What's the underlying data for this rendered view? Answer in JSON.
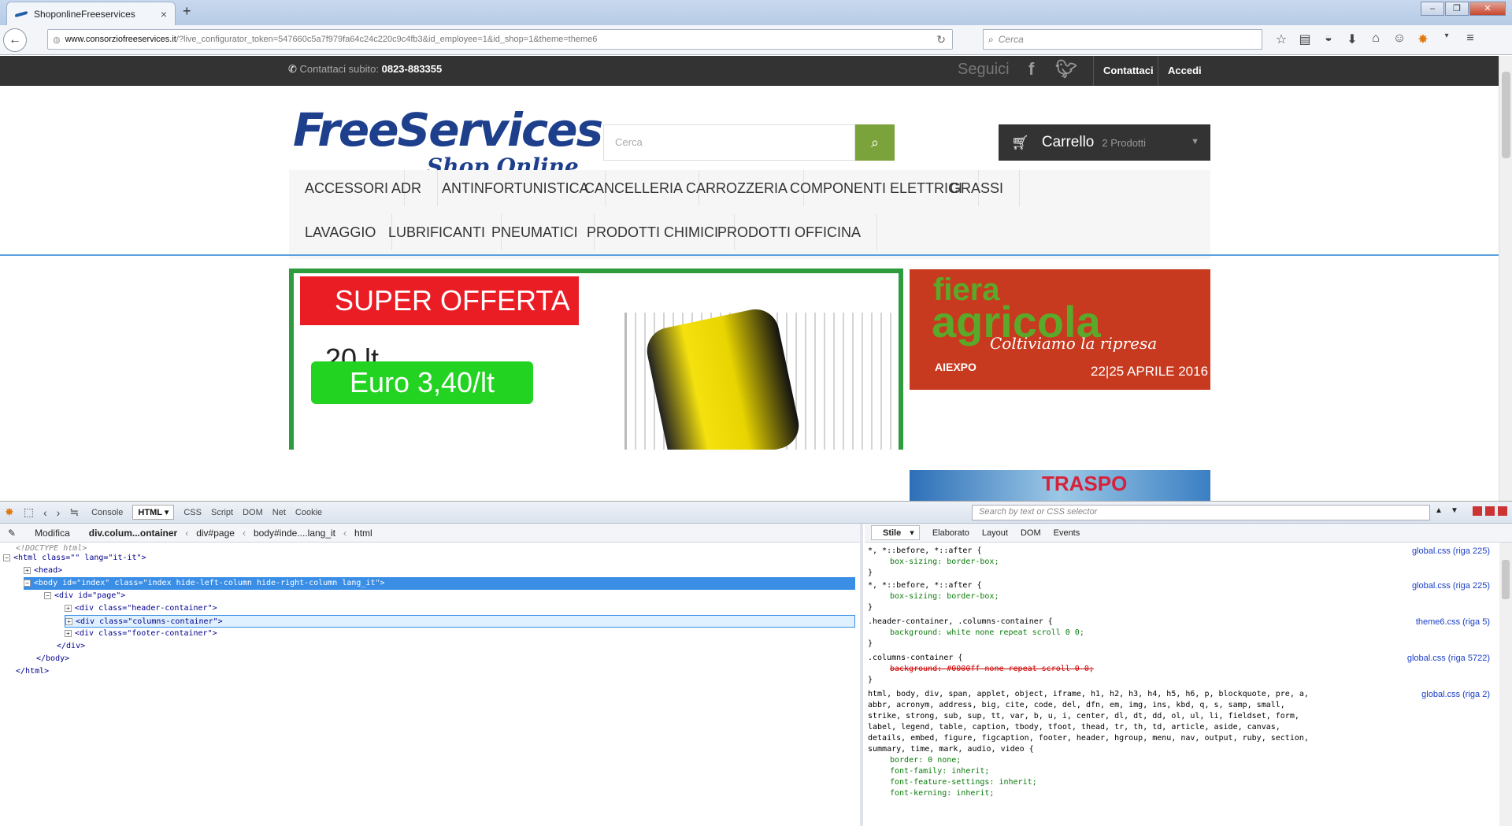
{
  "browser": {
    "tab_title": "ShoponlineFreeservices",
    "url_domain": "www.consorziofreeservices.it",
    "url_path": "/?live_configurator_token=547660c5a7f979fa64c24c220c9c4fb3&id_employee=1&id_shop=1&theme=theme6",
    "search_placeholder": "Cerca"
  },
  "site": {
    "topbar": {
      "contact_label": "Contattaci subito:",
      "phone": "0823-883355",
      "follow": "Seguici",
      "contact_link": "Contattaci",
      "login": "Accedi"
    },
    "logo": {
      "line1": "FreeServices",
      "line2": "Shop Online"
    },
    "search_placeholder": "Cerca",
    "cart": {
      "label": "Carrello",
      "count": "2 Prodotti"
    },
    "menu": [
      "ACCESSORI",
      "ADR",
      "ANTINFORTUNISTICA",
      "CANCELLERIA",
      "CARROZZERIA",
      "COMPONENTI ELETTRICI",
      "GRASSI",
      "LAVAGGIO",
      "LUBRIFICANTI",
      "PNEUMATICI",
      "PRODOTTI CHIMICI",
      "PRODOTTI OFFICINA"
    ],
    "promo": {
      "title": "SUPER OFFERTA",
      "size": "20 lt",
      "price": "Euro 3,40/lt"
    },
    "banner_fiera": {
      "a": "fiera",
      "b": "agricola",
      "slogan": "Coltiviamo la ripresa",
      "org": "AIEXPO",
      "dates": "22|25 APRILE 2016"
    },
    "banner_traspo": "TRASPO"
  },
  "devtools": {
    "tabs": [
      "Console",
      "HTML",
      "CSS",
      "Script",
      "DOM",
      "Net",
      "Cookie"
    ],
    "active_tab": "HTML",
    "search_placeholder": "Search by text or CSS selector",
    "edit": "Modifica",
    "breadcrumb": [
      "div.colum...ontainer",
      "div#page",
      "body#inde....lang_it",
      "html"
    ],
    "style_tabs": [
      "Stile",
      "Elaborato",
      "Layout",
      "DOM",
      "Events"
    ],
    "tree": [
      "<!DOCTYPE html>",
      "<html class=\"\" lang=\"it-it\">",
      "<head>",
      "<body id=\"index\" class=\"index hide-left-column hide-right-column lang_it\">",
      "<div id=\"page\">",
      "<div class=\"header-container\">",
      "<div class=\"columns-container\">",
      "<div class=\"footer-container\">",
      "</div>",
      "</body>",
      "</html>"
    ],
    "rules": [
      {
        "sel": "*, *::before, *::after {",
        "props": [
          "box-sizing: border-box;"
        ],
        "src": "global.css (riga 225)"
      },
      {
        "sel": "*, *::before, *::after {",
        "props": [
          "box-sizing: border-box;"
        ],
        "src": "global.css (riga 225)"
      },
      {
        "sel": ".header-container, .columns-container {",
        "props": [
          "background: white none repeat scroll 0 0;"
        ],
        "src": "theme6.css (riga 5)"
      },
      {
        "sel": ".columns-container {",
        "props": [
          "background: #0000ff none repeat scroll 0 0;"
        ],
        "src": "global.css (riga 5722)"
      },
      {
        "sel": "html, body, div, span, applet, object, iframe, h1, h2, h3, h4, h5, h6, p, blockquote, pre, a,",
        "sel2": "abbr, acronym, address, big, cite, code, del, dfn, em, img, ins, kbd, q, s, samp, small,",
        "sel3": "strike, strong, sub, sup, tt, var, b, u, i, center, dl, dt, dd, ol, ul, li, fieldset, form,",
        "sel4": "label, legend, table, caption, tbody, tfoot, thead, tr, th, td, article, aside, canvas,",
        "sel5": "details, embed, figure, figcaption, footer, header, hgroup, menu, nav, output, ruby, section,",
        "sel6": "summary, time, mark, audio, video {",
        "props": [
          "border: 0 none;",
          "font-family: inherit;",
          "font-feature-settings: inherit;",
          "font-kerning: inherit;"
        ],
        "src": "global.css (riga 2)"
      }
    ]
  }
}
